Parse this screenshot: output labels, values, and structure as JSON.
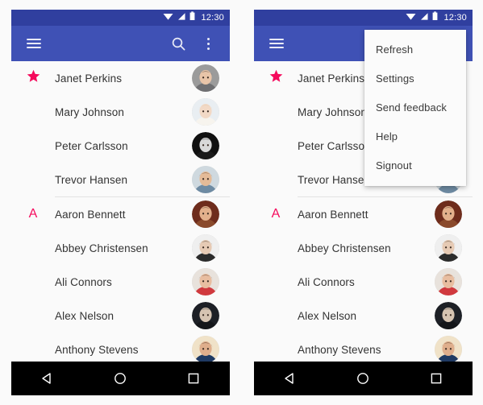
{
  "status_bar": {
    "time": "12:30",
    "icons": [
      "wifi-icon",
      "signal-icon",
      "battery-icon"
    ]
  },
  "app_bar": {
    "menu_icon": "hamburger-menu-icon",
    "search_icon": "search-icon",
    "overflow_icon": "overflow-menu-icon",
    "title": ""
  },
  "nav_bar": {
    "back_label": "back-icon",
    "home_label": "home-icon",
    "recents_label": "recents-icon"
  },
  "colors": {
    "status_bar": "#303F9F",
    "app_bar": "#3F51B5",
    "accent_pink": "#F50A5C",
    "surface": "#FAFAFA",
    "nav_bar": "#000000",
    "divider": "#E3E3E3",
    "text_primary": "#333333"
  },
  "contacts": {
    "sections": [
      {
        "header": "star-icon",
        "header_type": "star",
        "items": [
          {
            "name": "Janet Perkins",
            "avatar": "avatar-janet-perkins"
          },
          {
            "name": "Mary Johnson",
            "avatar": "avatar-mary-johnson"
          },
          {
            "name": "Peter Carlsson",
            "avatar": "avatar-peter-carlsson"
          },
          {
            "name": "Trevor Hansen",
            "avatar": "avatar-trevor-hansen"
          }
        ]
      },
      {
        "header": "A",
        "header_type": "letter",
        "items": [
          {
            "name": "Aaron Bennett",
            "avatar": "avatar-aaron-bennett"
          },
          {
            "name": "Abbey Christensen",
            "avatar": "avatar-abbey-christensen"
          },
          {
            "name": "Ali Connors",
            "avatar": "avatar-ali-connors"
          },
          {
            "name": "Alex Nelson",
            "avatar": "avatar-alex-nelson"
          },
          {
            "name": "Anthony Stevens",
            "avatar": "avatar-anthony-stevens"
          }
        ]
      }
    ]
  },
  "overflow_menu": {
    "items": [
      {
        "label": "Refresh"
      },
      {
        "label": "Settings"
      },
      {
        "label": "Send feedback"
      },
      {
        "label": "Help"
      },
      {
        "label": "Signout"
      }
    ]
  }
}
